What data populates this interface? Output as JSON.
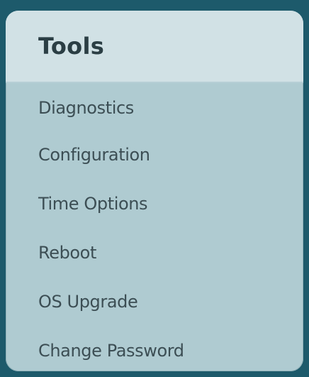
{
  "panel": {
    "title": "Tools",
    "items": [
      {
        "label": "Diagnostics"
      },
      {
        "label": "Configuration"
      },
      {
        "label": "Time Options"
      },
      {
        "label": "Reboot"
      },
      {
        "label": "OS Upgrade"
      },
      {
        "label": "Change Password"
      }
    ]
  },
  "colors": {
    "background": "#1d5a6b",
    "panel": "#afcbd1",
    "header": "#d1e1e5",
    "title_text": "#2b3e44",
    "item_text": "#3c4e54"
  }
}
